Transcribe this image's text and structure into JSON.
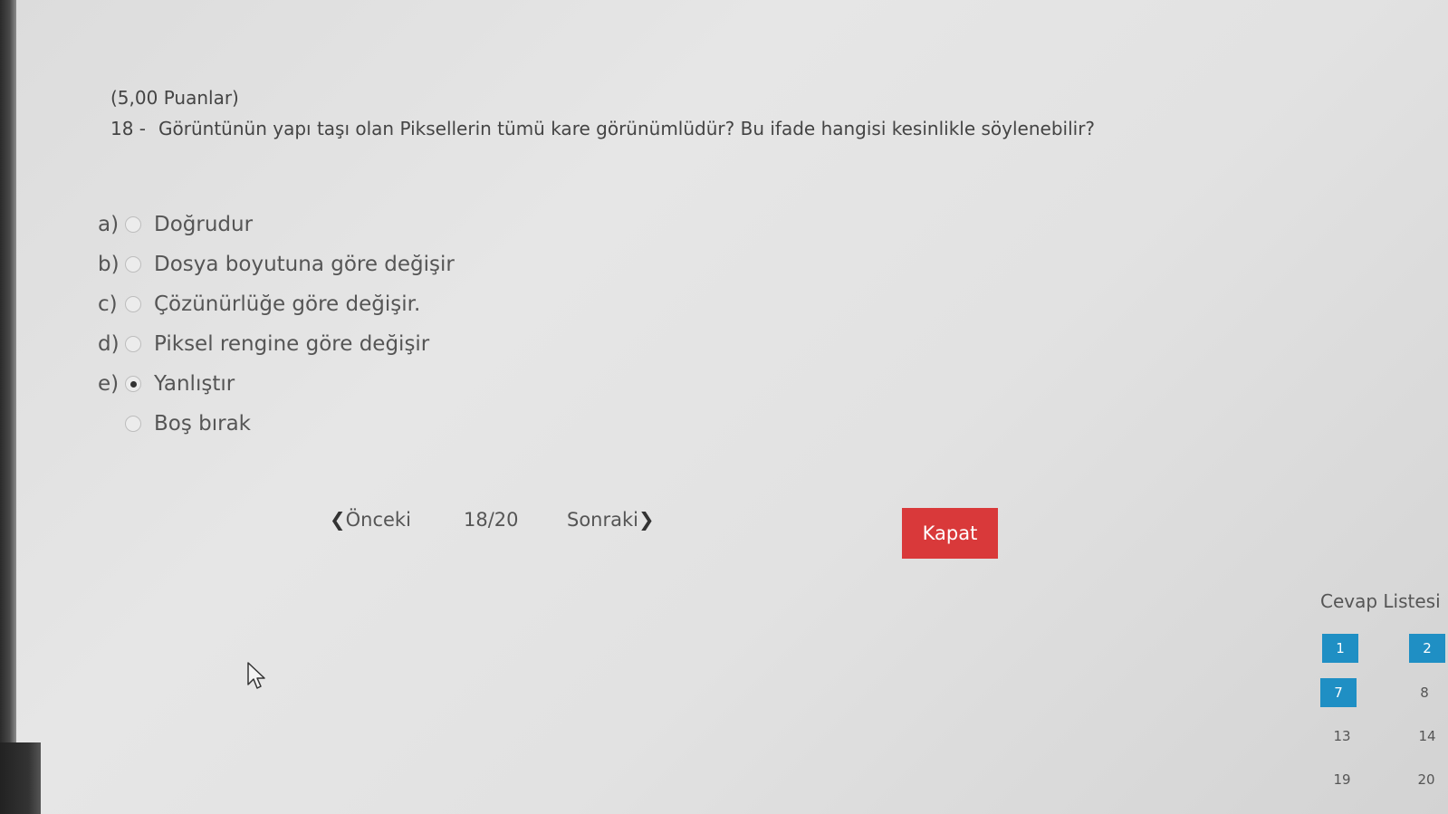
{
  "question": {
    "points": "(5,00 Puanlar)",
    "number": "18 -",
    "text": "Görüntünün yapı taşı olan Piksellerin tümü kare görünümlüdür? Bu ifade hangisi kesinlikle söylenebilir?"
  },
  "options": [
    {
      "letter": "a)",
      "text": "Doğrudur",
      "selected": false
    },
    {
      "letter": "b)",
      "text": "Dosya boyutuna göre değişir",
      "selected": false
    },
    {
      "letter": "c)",
      "text": "Çözünürlüğe göre değişir.",
      "selected": false
    },
    {
      "letter": "d)",
      "text": "Piksel rengine göre değişir",
      "selected": false
    },
    {
      "letter": "e)",
      "text": "Yanlıştır",
      "selected": true
    },
    {
      "letter": "",
      "text": "Boş bırak",
      "selected": false
    }
  ],
  "nav": {
    "prev_label": "Önceki",
    "counter": "18/20",
    "next_label": "Sonraki",
    "close_label": "Kapat"
  },
  "answer_list": {
    "title": "Cevap Listesi",
    "items": [
      {
        "label": "1",
        "answered": true
      },
      {
        "label": "2",
        "answered": true
      },
      {
        "label": "7",
        "answered": true
      },
      {
        "label": "8",
        "answered": false
      },
      {
        "label": "13",
        "answered": false
      },
      {
        "label": "14",
        "answered": false
      },
      {
        "label": "19",
        "answered": false
      },
      {
        "label": "20",
        "answered": false
      }
    ]
  },
  "colors": {
    "close_button": "#d9393a",
    "answered_item": "#1f8fc4"
  },
  "icons": {
    "prev": "chevron-left-icon",
    "next": "chevron-right-icon",
    "cursor": "mouse-pointer-icon"
  }
}
